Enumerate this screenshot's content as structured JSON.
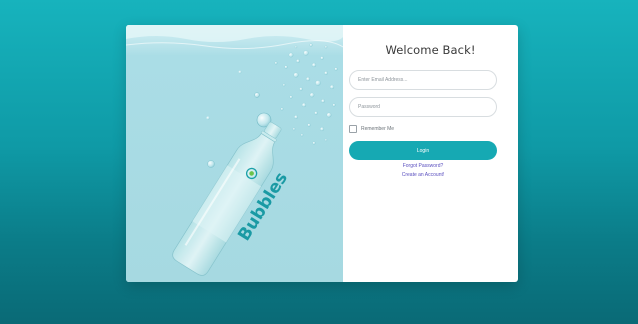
{
  "form": {
    "title": "Welcome Back!",
    "email_placeholder": "Enter Email Address...",
    "password_placeholder": "Password",
    "remember_label": "Remember Me",
    "login_label": "Login",
    "forgot_label": "Forgot Password?",
    "create_label": "Create an Account!"
  },
  "hero": {
    "brand": "Bubbles"
  },
  "colors": {
    "accent": "#16a9b3",
    "link": "#5a4fbf",
    "page_bg": "#0f9aa6"
  }
}
